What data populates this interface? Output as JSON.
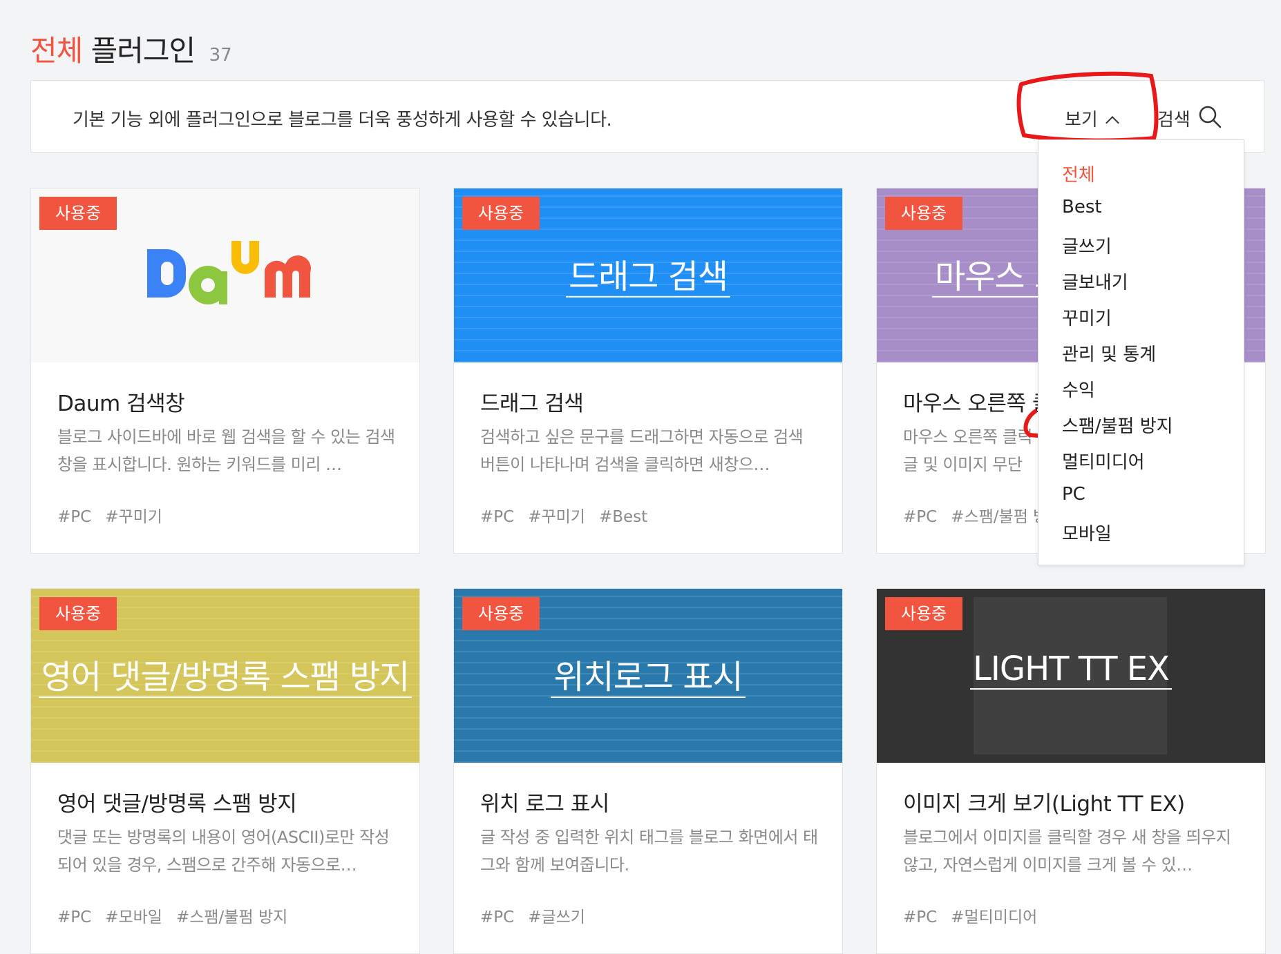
{
  "header": {
    "title_accent": "전체",
    "title_main": "플러그인",
    "count": "37"
  },
  "infobar": {
    "description": "기본 기능 외에 플러그인으로 블로그를 더욱 풍성하게 사용할 수 있습니다.",
    "view_label": "보기",
    "search_label": "검색"
  },
  "dropdown": {
    "items": [
      "전체",
      "Best",
      "글쓰기",
      "글보내기",
      "꾸미기",
      "관리 및 통계",
      "수익",
      "스팸/불펌 방지",
      "멀티미디어",
      "PC",
      "모바일"
    ],
    "active": "전체"
  },
  "cards": [
    {
      "badge": "사용중",
      "thumb_title": "",
      "thumb_color": "#f8f8f8",
      "name": "Daum 검색창",
      "description": "블로그 사이드바에 바로 웹 검색을 할 수 있는 검색창을 표시합니다. 원하는 키워드를 미리 …",
      "tags": [
        "#PC",
        "#꾸미기"
      ]
    },
    {
      "badge": "사용중",
      "thumb_title": "드래그 검색",
      "thumb_color": "#1f8ef5",
      "name": "드래그 검색",
      "description": "검색하고 싶은 문구를 드래그하면 자동으로 검색 버튼이 나타나며 검색을 클릭하면 새창으…",
      "tags": [
        "#PC",
        "#꾸미기",
        "#Best"
      ]
    },
    {
      "badge": "사용중",
      "thumb_title": "마우스 오",
      "thumb_color": "#a78ec8",
      "name": "마우스 오른쪽 클",
      "description": "마우스 오른쪽 클릭 글 및 이미지 무단 복",
      "tags": [
        "#PC",
        "#스팸/불펌 방"
      ]
    },
    {
      "badge": "사용중",
      "thumb_title": "영어 댓글/방명록 스팸 방지",
      "thumb_color": "#d4c65a",
      "name": "영어 댓글/방명록 스팸 방지",
      "description": "댓글 또는 방명록의 내용이 영어(ASCII)로만 작성되어 있을 경우, 스팸으로 간주해 자동으로…",
      "tags": [
        "#PC",
        "#모바일",
        "#스팸/불펌 방지"
      ]
    },
    {
      "badge": "사용중",
      "thumb_title": "위치로그 표시",
      "thumb_color": "#2a79ad",
      "name": "위치 로그 표시",
      "description": "글 작성 중 입력한 위치 태그를 블로그 화면에서 태그와 함께 보여줍니다.",
      "tags": [
        "#PC",
        "#글쓰기"
      ]
    },
    {
      "badge": "사용중",
      "thumb_title": "LIGHT TT EX",
      "thumb_color": "#333333",
      "name": "이미지 크게 보기(Light TT EX)",
      "description": "블로그에서 이미지를 클릭할 경우 새 창을 띄우지 않고, 자연스럽게 이미지를 크게 볼 수 있…",
      "tags": [
        "#PC",
        "#멀티미디어"
      ]
    }
  ],
  "colors": {
    "accent": "#f1543f",
    "annotation": "#e8191b"
  }
}
